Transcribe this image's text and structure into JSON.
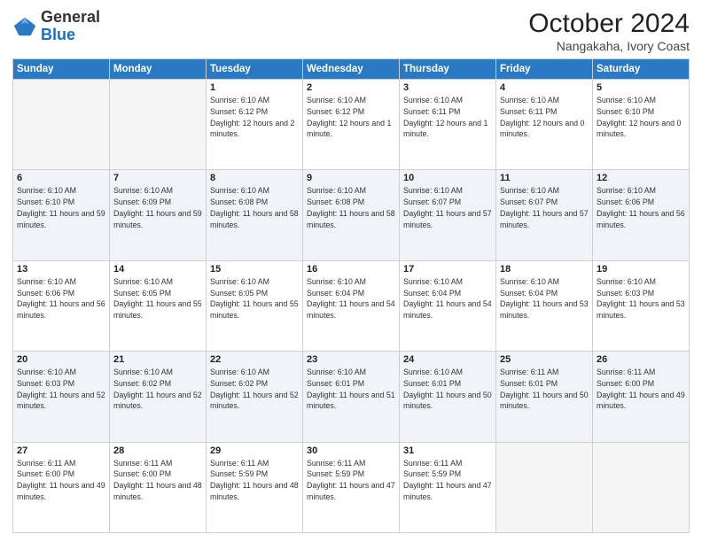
{
  "logo": {
    "general": "General",
    "blue": "Blue"
  },
  "title": "October 2024",
  "subtitle": "Nangakaha, Ivory Coast",
  "days_header": [
    "Sunday",
    "Monday",
    "Tuesday",
    "Wednesday",
    "Thursday",
    "Friday",
    "Saturday"
  ],
  "weeks": [
    [
      {
        "num": "",
        "sunrise": "",
        "sunset": "",
        "daylight": "",
        "empty": true
      },
      {
        "num": "",
        "sunrise": "",
        "sunset": "",
        "daylight": "",
        "empty": true
      },
      {
        "num": "1",
        "sunrise": "Sunrise: 6:10 AM",
        "sunset": "Sunset: 6:12 PM",
        "daylight": "Daylight: 12 hours and 2 minutes."
      },
      {
        "num": "2",
        "sunrise": "Sunrise: 6:10 AM",
        "sunset": "Sunset: 6:12 PM",
        "daylight": "Daylight: 12 hours and 1 minute."
      },
      {
        "num": "3",
        "sunrise": "Sunrise: 6:10 AM",
        "sunset": "Sunset: 6:11 PM",
        "daylight": "Daylight: 12 hours and 1 minute."
      },
      {
        "num": "4",
        "sunrise": "Sunrise: 6:10 AM",
        "sunset": "Sunset: 6:11 PM",
        "daylight": "Daylight: 12 hours and 0 minutes."
      },
      {
        "num": "5",
        "sunrise": "Sunrise: 6:10 AM",
        "sunset": "Sunset: 6:10 PM",
        "daylight": "Daylight: 12 hours and 0 minutes."
      }
    ],
    [
      {
        "num": "6",
        "sunrise": "Sunrise: 6:10 AM",
        "sunset": "Sunset: 6:10 PM",
        "daylight": "Daylight: 11 hours and 59 minutes."
      },
      {
        "num": "7",
        "sunrise": "Sunrise: 6:10 AM",
        "sunset": "Sunset: 6:09 PM",
        "daylight": "Daylight: 11 hours and 59 minutes."
      },
      {
        "num": "8",
        "sunrise": "Sunrise: 6:10 AM",
        "sunset": "Sunset: 6:08 PM",
        "daylight": "Daylight: 11 hours and 58 minutes."
      },
      {
        "num": "9",
        "sunrise": "Sunrise: 6:10 AM",
        "sunset": "Sunset: 6:08 PM",
        "daylight": "Daylight: 11 hours and 58 minutes."
      },
      {
        "num": "10",
        "sunrise": "Sunrise: 6:10 AM",
        "sunset": "Sunset: 6:07 PM",
        "daylight": "Daylight: 11 hours and 57 minutes."
      },
      {
        "num": "11",
        "sunrise": "Sunrise: 6:10 AM",
        "sunset": "Sunset: 6:07 PM",
        "daylight": "Daylight: 11 hours and 57 minutes."
      },
      {
        "num": "12",
        "sunrise": "Sunrise: 6:10 AM",
        "sunset": "Sunset: 6:06 PM",
        "daylight": "Daylight: 11 hours and 56 minutes."
      }
    ],
    [
      {
        "num": "13",
        "sunrise": "Sunrise: 6:10 AM",
        "sunset": "Sunset: 6:06 PM",
        "daylight": "Daylight: 11 hours and 56 minutes."
      },
      {
        "num": "14",
        "sunrise": "Sunrise: 6:10 AM",
        "sunset": "Sunset: 6:05 PM",
        "daylight": "Daylight: 11 hours and 55 minutes."
      },
      {
        "num": "15",
        "sunrise": "Sunrise: 6:10 AM",
        "sunset": "Sunset: 6:05 PM",
        "daylight": "Daylight: 11 hours and 55 minutes."
      },
      {
        "num": "16",
        "sunrise": "Sunrise: 6:10 AM",
        "sunset": "Sunset: 6:04 PM",
        "daylight": "Daylight: 11 hours and 54 minutes."
      },
      {
        "num": "17",
        "sunrise": "Sunrise: 6:10 AM",
        "sunset": "Sunset: 6:04 PM",
        "daylight": "Daylight: 11 hours and 54 minutes."
      },
      {
        "num": "18",
        "sunrise": "Sunrise: 6:10 AM",
        "sunset": "Sunset: 6:04 PM",
        "daylight": "Daylight: 11 hours and 53 minutes."
      },
      {
        "num": "19",
        "sunrise": "Sunrise: 6:10 AM",
        "sunset": "Sunset: 6:03 PM",
        "daylight": "Daylight: 11 hours and 53 minutes."
      }
    ],
    [
      {
        "num": "20",
        "sunrise": "Sunrise: 6:10 AM",
        "sunset": "Sunset: 6:03 PM",
        "daylight": "Daylight: 11 hours and 52 minutes."
      },
      {
        "num": "21",
        "sunrise": "Sunrise: 6:10 AM",
        "sunset": "Sunset: 6:02 PM",
        "daylight": "Daylight: 11 hours and 52 minutes."
      },
      {
        "num": "22",
        "sunrise": "Sunrise: 6:10 AM",
        "sunset": "Sunset: 6:02 PM",
        "daylight": "Daylight: 11 hours and 52 minutes."
      },
      {
        "num": "23",
        "sunrise": "Sunrise: 6:10 AM",
        "sunset": "Sunset: 6:01 PM",
        "daylight": "Daylight: 11 hours and 51 minutes."
      },
      {
        "num": "24",
        "sunrise": "Sunrise: 6:10 AM",
        "sunset": "Sunset: 6:01 PM",
        "daylight": "Daylight: 11 hours and 50 minutes."
      },
      {
        "num": "25",
        "sunrise": "Sunrise: 6:11 AM",
        "sunset": "Sunset: 6:01 PM",
        "daylight": "Daylight: 11 hours and 50 minutes."
      },
      {
        "num": "26",
        "sunrise": "Sunrise: 6:11 AM",
        "sunset": "Sunset: 6:00 PM",
        "daylight": "Daylight: 11 hours and 49 minutes."
      }
    ],
    [
      {
        "num": "27",
        "sunrise": "Sunrise: 6:11 AM",
        "sunset": "Sunset: 6:00 PM",
        "daylight": "Daylight: 11 hours and 49 minutes."
      },
      {
        "num": "28",
        "sunrise": "Sunrise: 6:11 AM",
        "sunset": "Sunset: 6:00 PM",
        "daylight": "Daylight: 11 hours and 48 minutes."
      },
      {
        "num": "29",
        "sunrise": "Sunrise: 6:11 AM",
        "sunset": "Sunset: 5:59 PM",
        "daylight": "Daylight: 11 hours and 48 minutes."
      },
      {
        "num": "30",
        "sunrise": "Sunrise: 6:11 AM",
        "sunset": "Sunset: 5:59 PM",
        "daylight": "Daylight: 11 hours and 47 minutes."
      },
      {
        "num": "31",
        "sunrise": "Sunrise: 6:11 AM",
        "sunset": "Sunset: 5:59 PM",
        "daylight": "Daylight: 11 hours and 47 minutes."
      },
      {
        "num": "",
        "sunrise": "",
        "sunset": "",
        "daylight": "",
        "empty": true
      },
      {
        "num": "",
        "sunrise": "",
        "sunset": "",
        "daylight": "",
        "empty": true
      }
    ]
  ]
}
